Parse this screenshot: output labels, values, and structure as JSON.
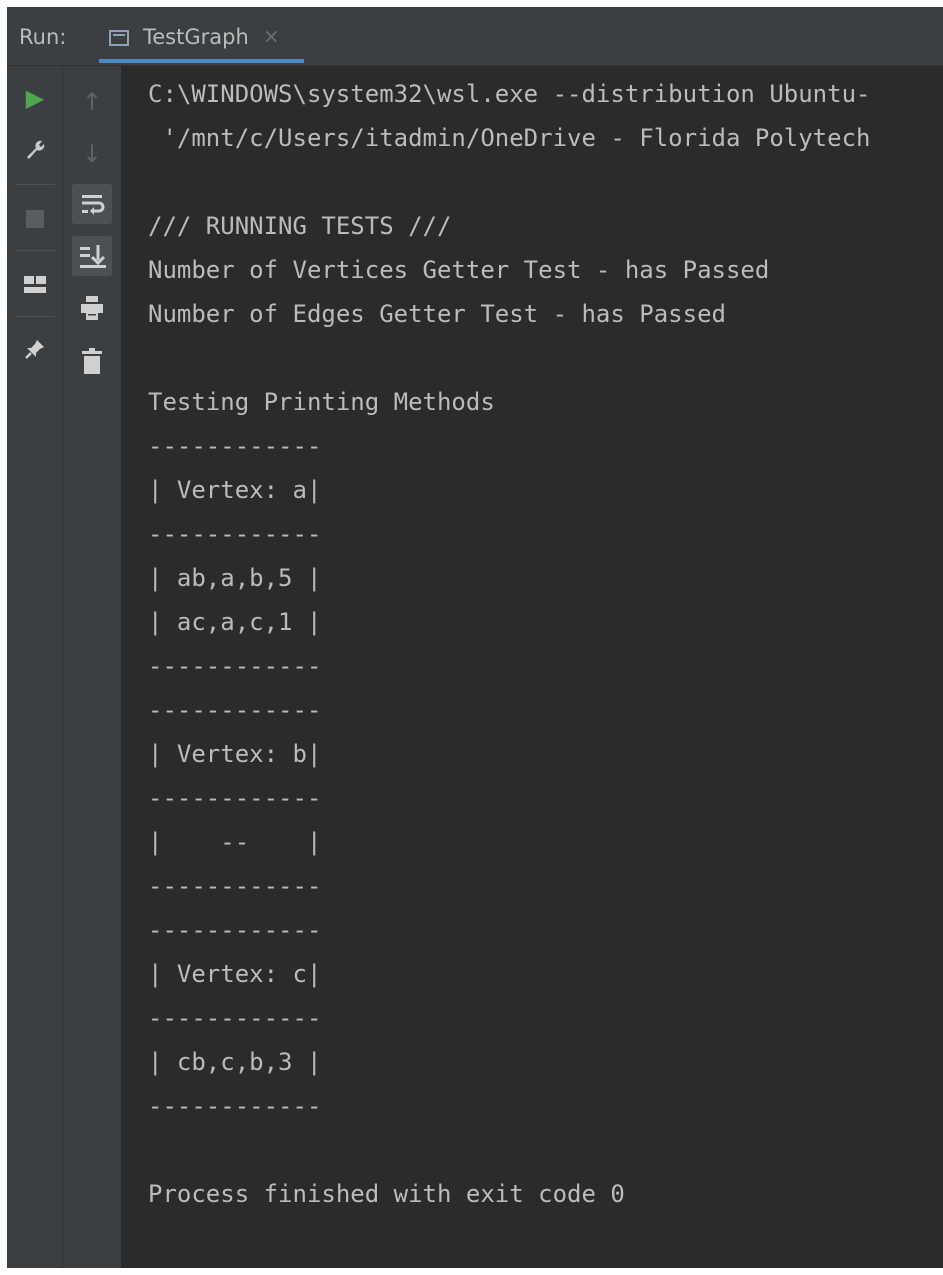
{
  "run_panel": {
    "label": "Run:",
    "tab": {
      "title": "TestGraph",
      "close": "×"
    }
  },
  "toolbar": {
    "left": [
      {
        "name": "rerun-icon",
        "glyph": "▶"
      },
      {
        "name": "wrench-icon",
        "glyph": "🔧"
      },
      {
        "name": "stop-icon",
        "glyph": "■"
      },
      {
        "name": "layout-icon",
        "glyph": "▀"
      },
      {
        "name": "pin-icon",
        "glyph": "📌"
      }
    ],
    "right": [
      {
        "name": "up-arrow-icon",
        "glyph": "↑"
      },
      {
        "name": "down-arrow-icon",
        "glyph": "↓"
      },
      {
        "name": "soft-wrap-icon",
        "glyph": "⤶"
      },
      {
        "name": "scroll-to-end-icon",
        "glyph": "⇊"
      },
      {
        "name": "print-icon",
        "glyph": "🖶"
      },
      {
        "name": "trash-icon",
        "glyph": "🗑"
      }
    ]
  },
  "console": {
    "lines": [
      "C:\\WINDOWS\\system32\\wsl.exe --distribution Ubuntu-",
      " '/mnt/c/Users/itadmin/OneDrive - Florida Polytech",
      "",
      "/// RUNNING TESTS ///",
      "Number of Vertices Getter Test - has Passed",
      "Number of Edges Getter Test - has Passed",
      "",
      "Testing Printing Methods",
      "------------",
      "| Vertex: a|",
      "------------",
      "| ab,a,b,5 |",
      "| ac,a,c,1 |",
      "------------",
      "------------",
      "| Vertex: b|",
      "------------",
      "|    --    |",
      "------------",
      "------------",
      "| Vertex: c|",
      "------------",
      "| cb,c,b,3 |",
      "------------",
      "",
      "Process finished with exit code 0"
    ]
  }
}
